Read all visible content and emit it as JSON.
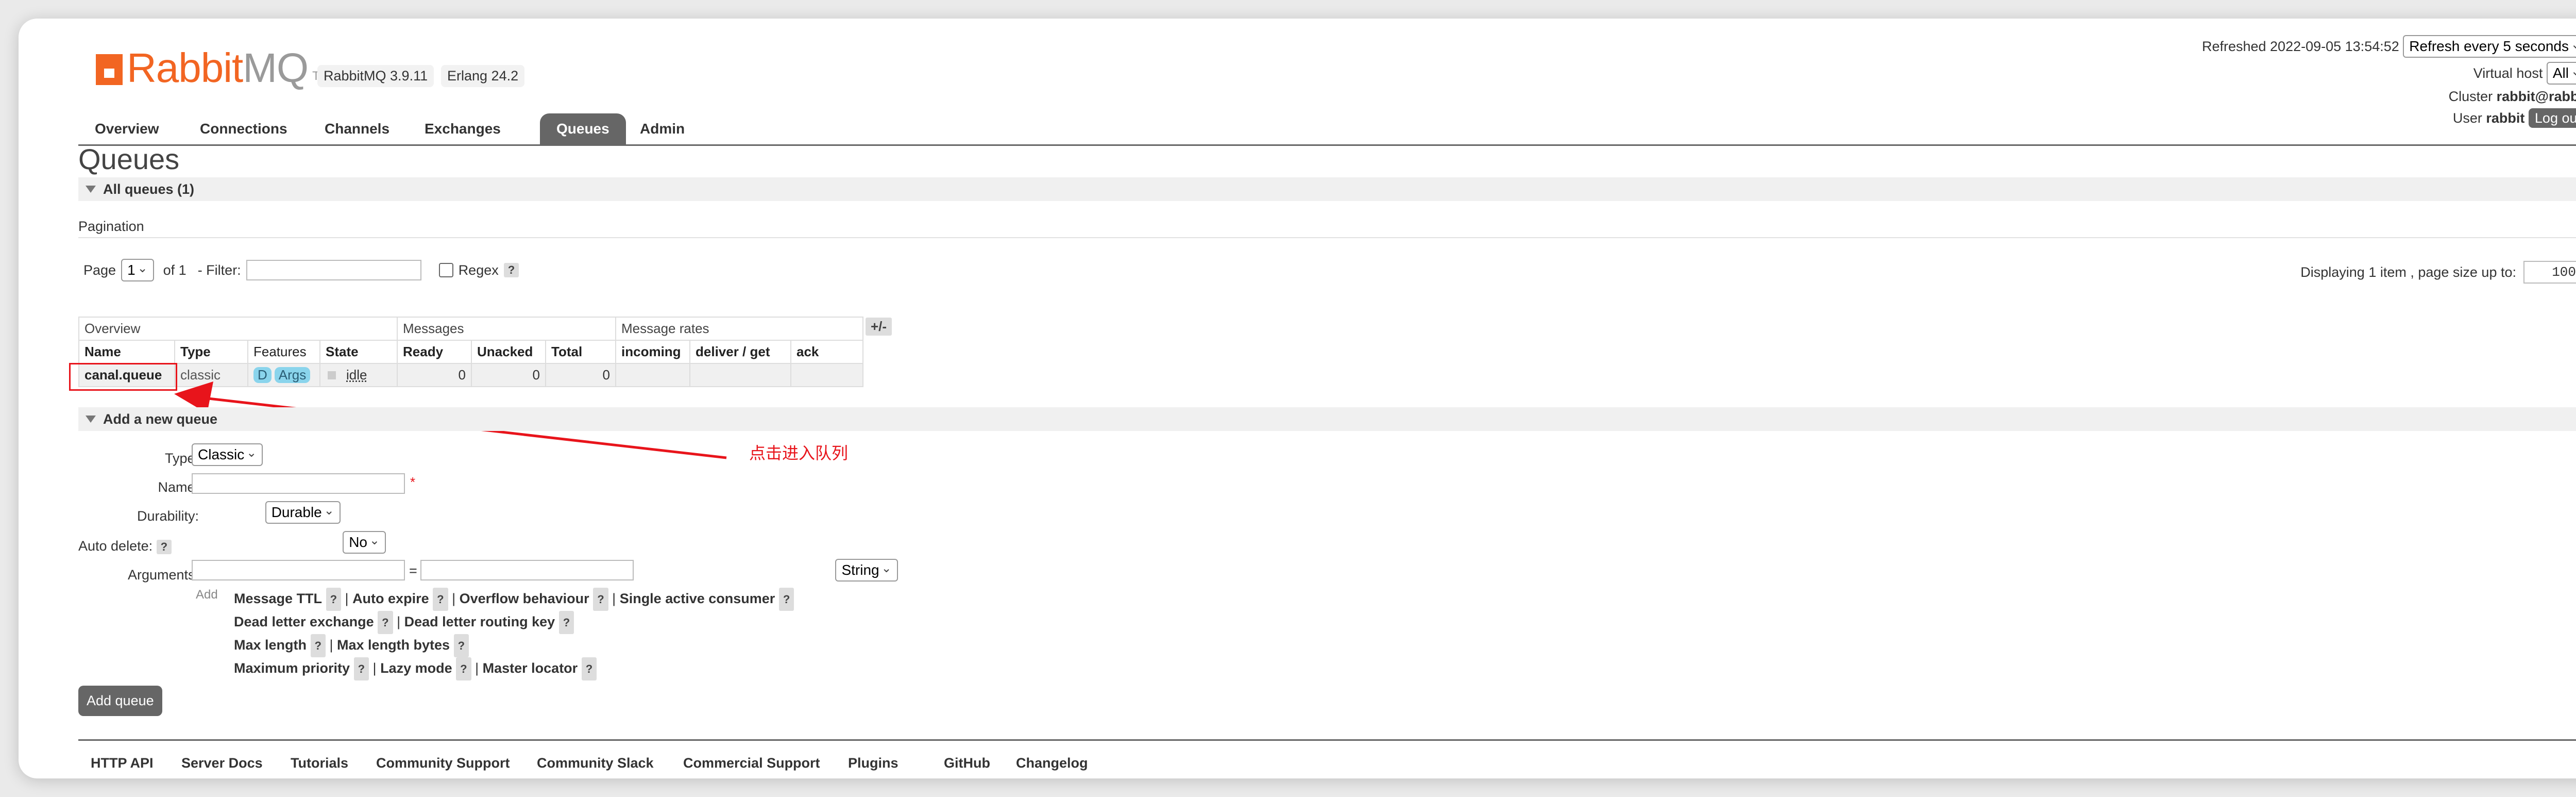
{
  "app": {
    "brand_rabbit": "Rabbit",
    "brand_mq": "MQ",
    "tm": "TM",
    "rabbitmq_version": "RabbitMQ 3.9.11",
    "erlang_version": "Erlang 24.2"
  },
  "nav": {
    "tabs": [
      "Overview",
      "Connections",
      "Channels",
      "Exchanges",
      "Queues",
      "Admin"
    ],
    "active": "Queues"
  },
  "status": {
    "refreshed": "Refreshed 2022-09-05 13:54:52",
    "refresh_interval": "Refresh every 5 seconds",
    "vhost_label": "Virtual host",
    "vhost_value": "All",
    "cluster_label": "Cluster",
    "cluster_value": "rabbit@rabbit",
    "user_label": "User",
    "user_value": "rabbit",
    "logout_label": "Log out"
  },
  "page": {
    "title": "Queues",
    "all_queues_label": "All queues (1)",
    "pagination_label": "Pagination",
    "page_label": "Page",
    "page_value": "1",
    "of_label": "of 1",
    "filter_label": "- Filter:",
    "regex_label": "Regex",
    "help": "?",
    "displaying": "Displaying 1 item , page size up to:",
    "page_size": "100"
  },
  "table": {
    "groups": [
      "Overview",
      "Messages",
      "Message rates"
    ],
    "plus_minus": "+/-",
    "headers": [
      "Name",
      "Type",
      "Features",
      "State",
      "Ready",
      "Unacked",
      "Total",
      "incoming",
      "deliver / get",
      "ack"
    ],
    "rows": [
      {
        "name": "canal.queue",
        "type": "classic",
        "feature_d": "D",
        "feature_args": "Args",
        "state": "idle",
        "ready": "0",
        "unacked": "0",
        "total": "0",
        "incoming": "",
        "deliver_get": "",
        "ack": ""
      }
    ]
  },
  "annotation": {
    "text": "点击进入队列",
    "color": "#e8141b"
  },
  "add_queue": {
    "section_label": "Add a new queue",
    "type_label": "Type:",
    "type_value": "Classic",
    "name_label": "Name:",
    "required_mark": "*",
    "durability_label": "Durability:",
    "durability_value": "Durable",
    "auto_delete_label": "Auto delete:",
    "auto_delete_value": "No",
    "arguments_label": "Arguments:",
    "equals": "=",
    "arg_type_value": "String",
    "add_label": "Add",
    "options": [
      [
        "Message TTL",
        "Auto expire",
        "Overflow behaviour",
        "Single active consumer"
      ],
      [
        "Dead letter exchange",
        "Dead letter routing key"
      ],
      [
        "Max length",
        "Max length bytes"
      ],
      [
        "Maximum priority",
        "Lazy mode",
        "Master locator"
      ]
    ],
    "separator": "|",
    "submit_label": "Add queue"
  },
  "footer": {
    "links": [
      "HTTP API",
      "Server Docs",
      "Tutorials",
      "Community Support",
      "Community Slack",
      "Commercial Support",
      "Plugins",
      "GitHub",
      "Changelog"
    ]
  },
  "colors": {
    "brand": "#f26522",
    "tab_active": "#666666",
    "feature_badge": "#8ad4ec",
    "highlight_box": "#e8141b"
  }
}
